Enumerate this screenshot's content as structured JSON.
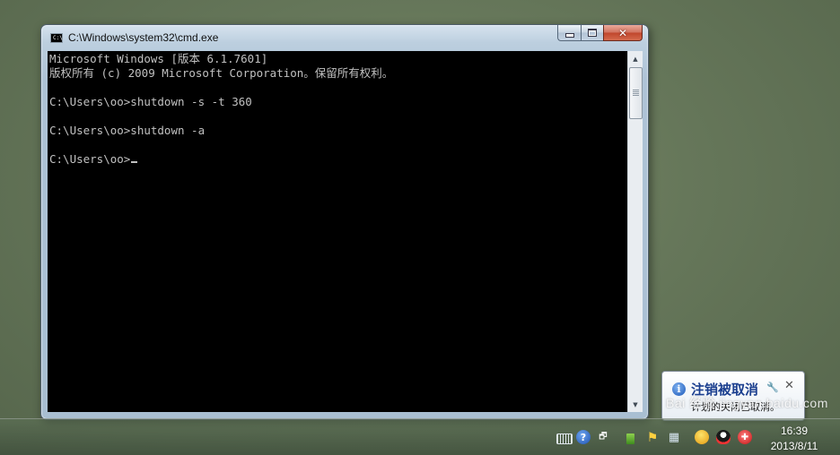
{
  "window": {
    "title": "C:\\Windows\\system32\\cmd.exe",
    "app_icon_text": "C:\\",
    "min_icon": "minimize-icon",
    "max_icon": "maximize-icon",
    "close_icon": "close-icon",
    "close_glyph": "✕"
  },
  "console": {
    "lines": [
      "Microsoft Windows [版本 6.1.7601]",
      "版权所有 (c) 2009 Microsoft Corporation。保留所有权利。",
      "",
      "C:\\Users\\oo>shutdown -s -t 360",
      "",
      "C:\\Users\\oo>shutdown -a",
      "",
      "C:\\Users\\oo>"
    ],
    "text_color": "#c0c0c0",
    "background": "#000000"
  },
  "notification": {
    "title": "注销被取消",
    "body": "计划的关闭已取消。",
    "info_glyph": "i",
    "wrench_glyph": "🔧",
    "close_glyph": "✕"
  },
  "taskbar": {
    "tray_icons": [
      "keyboard-icon",
      "help-icon",
      "windows-icon",
      "usb-icon",
      "flag-icon",
      "network-icon",
      "qq-icon",
      "penguin-icon",
      "shield-icon"
    ],
    "help_glyph": "?",
    "windows_glyph": "🗗",
    "flag_glyph": "⚑",
    "network_glyph": "▦",
    "shield_glyph": "✚",
    "clock_time": "16:39",
    "clock_date": "2013/8/11"
  },
  "watermark": "Bai 经验 jingyan.baidu.com"
}
